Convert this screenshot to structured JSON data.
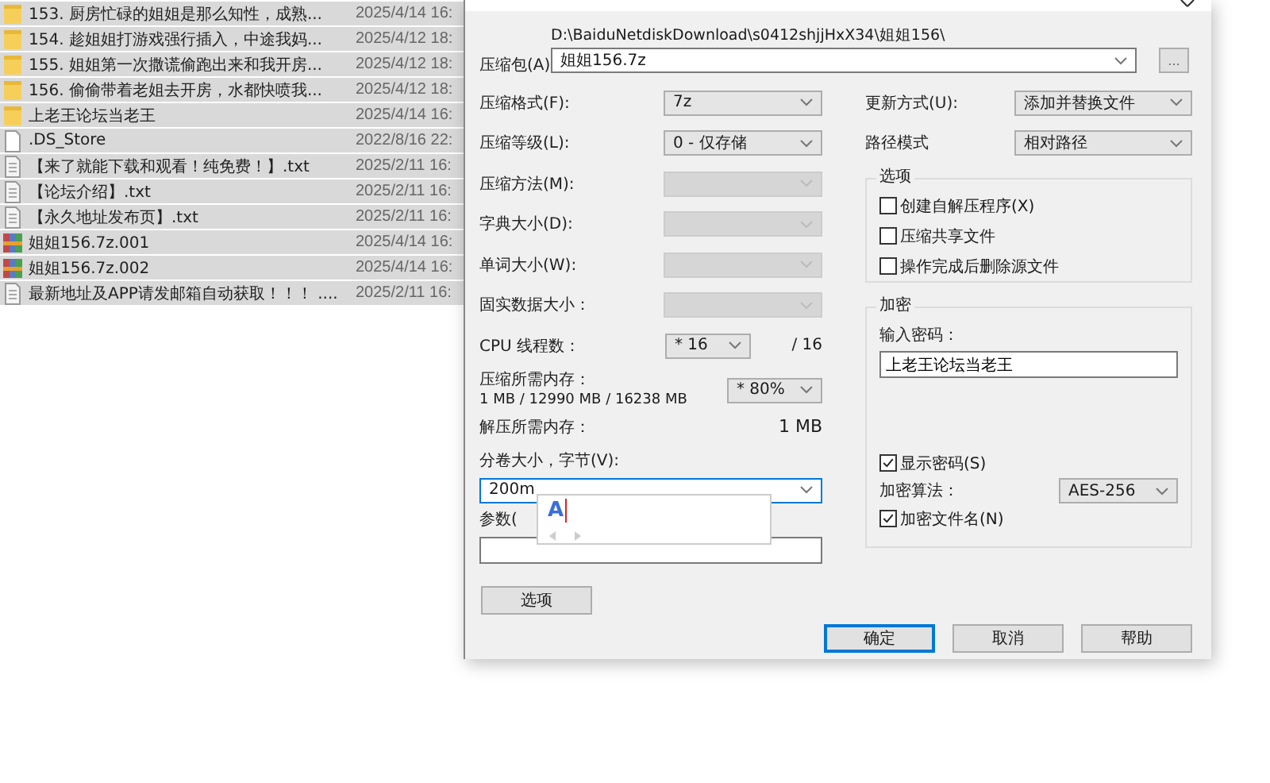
{
  "files": [
    {
      "name": "153. 厨房忙碌的姐姐是那么知性，成熟...",
      "date": "2025/4/14 16:",
      "kind": "folder",
      "selected": true
    },
    {
      "name": "154. 趁姐姐打游戏强行插入，中途我妈...",
      "date": "2025/4/12 18:",
      "kind": "folder",
      "selected": true
    },
    {
      "name": "155. 姐姐第一次撒谎偷跑出来和我开房...",
      "date": "2025/4/12 18:",
      "kind": "folder",
      "selected": true
    },
    {
      "name": "156. 偷偷带着老姐去开房，水都快喷我...",
      "date": "2025/4/12 18:",
      "kind": "folder",
      "selected": true
    },
    {
      "name": "上老王论坛当老王",
      "date": "2025/4/14 16:",
      "kind": "folder",
      "selected": true
    },
    {
      "name": ".DS_Store",
      "date": "2022/8/16 22:",
      "kind": "file",
      "selected": true
    },
    {
      "name": "【来了就能下载和观看！纯免费！】.txt",
      "date": "2025/2/11 16:",
      "kind": "text",
      "selected": true
    },
    {
      "name": "【论坛介绍】.txt",
      "date": "2025/2/11 16:",
      "kind": "text",
      "selected": true
    },
    {
      "name": "【永久地址发布页】.txt",
      "date": "2025/2/11 16:",
      "kind": "text",
      "selected": true
    },
    {
      "name": "姐姐156.7z.001",
      "date": "2025/4/14 16:",
      "kind": "archive",
      "selected": true
    },
    {
      "name": "姐姐156.7z.002",
      "date": "2025/4/14 16:",
      "kind": "archive",
      "selected": true
    },
    {
      "name": "最新地址及APP请发邮箱自动获取！！！ ....",
      "date": "2025/2/11 16:",
      "kind": "text",
      "selected": true
    }
  ],
  "dialog": {
    "archive": {
      "label": "压缩包(A)",
      "path": "D:\\BaiduNetdiskDownload\\s0412shjjHxX34\\姐姐156\\",
      "value": "姐姐156.7z",
      "browse": "..."
    },
    "left_rows": [
      {
        "label": "压缩格式(F):",
        "value": "7z",
        "disabled": false
      },
      {
        "label": "压缩等级(L):",
        "value": "0 - 仅存储",
        "disabled": false
      },
      {
        "label": "压缩方法(M):",
        "disabled": true
      },
      {
        "label": "字典大小(D):",
        "disabled": true
      },
      {
        "label": "单词大小(W):",
        "disabled": true
      },
      {
        "label": "固实数据大小：",
        "disabled": true
      }
    ],
    "threads": {
      "label": "CPU 线程数：",
      "value": "* 16",
      "max": "/ 16"
    },
    "memory": {
      "label": "压缩所需内存：",
      "detail": "1 MB / 12990 MB / 16238 MB",
      "value": "* 80%"
    },
    "decompress_memory": {
      "label": "解压所需内存：",
      "value": "1 MB"
    },
    "volume": {
      "label": "分卷大小，字节(V):",
      "value": "200m",
      "focused": true
    },
    "ime_popup": {
      "text": "A"
    },
    "parameters": {
      "label": "参数("
    },
    "options_button": "选项",
    "update_mode": {
      "label": "更新方式(U):",
      "value": "添加并替换文件"
    },
    "path_mode": {
      "label": "路径模式",
      "value": "相对路径"
    },
    "options_group": {
      "title": "选项",
      "checkboxes": [
        {
          "label": "创建自解压程序(X)",
          "checked": false
        },
        {
          "label": "压缩共享文件",
          "checked": false
        },
        {
          "label": "操作完成后删除源文件",
          "checked": false
        }
      ]
    },
    "encryption": {
      "title": "加密",
      "password_label": "输入密码：",
      "password": "上老王论坛当老王",
      "show_password": {
        "label": "显示密码(S)",
        "checked": true
      },
      "method_label": "加密算法：",
      "method": "AES-256",
      "encrypt_names": {
        "label": "加密文件名(N)",
        "checked": true
      }
    },
    "buttons": [
      {
        "label": "确定",
        "focused": true
      },
      {
        "label": "取消",
        "focused": false
      },
      {
        "label": "帮助",
        "focused": false
      }
    ]
  }
}
